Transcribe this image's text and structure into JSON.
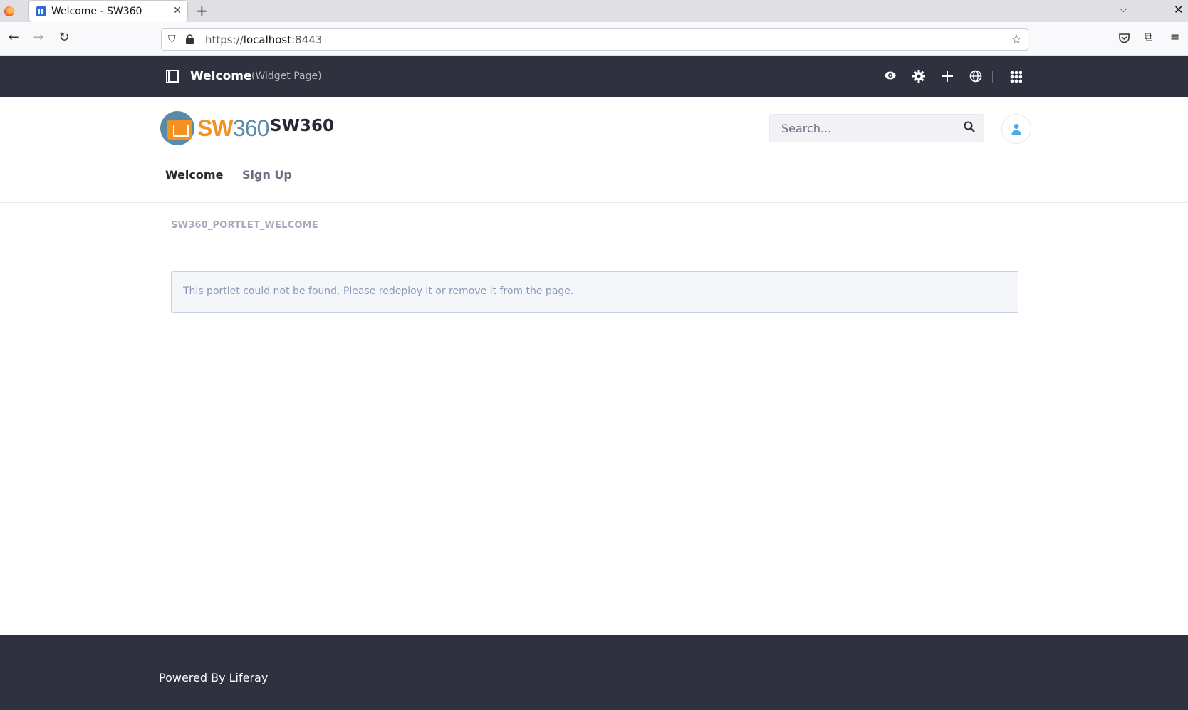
{
  "browser": {
    "tab_title": "Welcome - SW360",
    "url_prefix": "https://",
    "url_host": "localhost",
    "url_port": ":8443"
  },
  "control_menu": {
    "page_title": "Welcome",
    "page_type": "(Widget Page)",
    "icons": [
      "eye-icon",
      "gear-icon",
      "plus-icon",
      "globe-icon",
      "apps-icon"
    ]
  },
  "header": {
    "logo_text_sw": "SW",
    "logo_text_360": "360",
    "site_name": "SW360",
    "search_placeholder": "Search...",
    "nav": [
      {
        "label": "Welcome",
        "active": true
      },
      {
        "label": "Sign Up",
        "active": false
      }
    ]
  },
  "content": {
    "portlet_title": "SW360_PORTLET_WELCOME",
    "alert_message": "This portlet could not be found. Please redeploy it or remove it from the page."
  },
  "footer": {
    "text": "Powered By Liferay"
  },
  "colors": {
    "control_menu_bg": "#30313f",
    "logo_orange": "#f39222",
    "logo_blue": "#5a8aa8",
    "avatar_icon": "#4fa8e8"
  }
}
